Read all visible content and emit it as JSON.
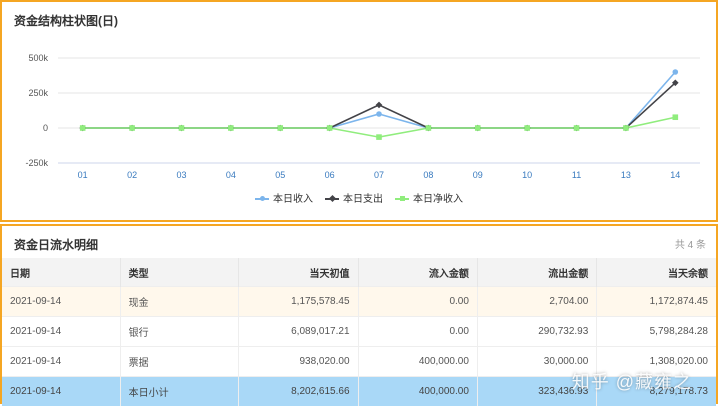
{
  "chart_panel": {
    "title": "资金结构柱状图(日)"
  },
  "chart_data": {
    "type": "line",
    "x": [
      "01",
      "02",
      "03",
      "04",
      "05",
      "06",
      "07",
      "08",
      "09",
      "10",
      "11",
      "13",
      "14"
    ],
    "y_ticks": [
      "500k",
      "250k",
      "0",
      "-250k"
    ],
    "ylim": [
      -250000,
      500000
    ],
    "grid": true,
    "legend_position": "bottom",
    "series": [
      {
        "name": "本日收入",
        "color": "#7cb5ec",
        "marker": "circle",
        "values": [
          0,
          0,
          0,
          0,
          0,
          0,
          100000,
          0,
          0,
          0,
          0,
          0,
          400000
        ]
      },
      {
        "name": "本日支出",
        "color": "#434348",
        "marker": "diamond",
        "values": [
          0,
          0,
          0,
          0,
          0,
          0,
          165000,
          0,
          0,
          0,
          0,
          0,
          323000
        ]
      },
      {
        "name": "本日净收入",
        "color": "#90ed7d",
        "marker": "square",
        "values": [
          0,
          0,
          0,
          0,
          0,
          0,
          -65000,
          0,
          0,
          0,
          0,
          0,
          77000
        ]
      }
    ]
  },
  "table_panel": {
    "title": "资金日流水明细",
    "count": "共 4 条",
    "columns": [
      "日期",
      "类型",
      "当天初值",
      "流入金额",
      "流出金额",
      "当天余额"
    ],
    "rows": [
      [
        "2021-09-14",
        "现金",
        "1,175,578.45",
        "0.00",
        "2,704.00",
        "1,172,874.45"
      ],
      [
        "2021-09-14",
        "银行",
        "6,089,017.21",
        "0.00",
        "290,732.93",
        "5,798,284.28"
      ],
      [
        "2021-09-14",
        "票据",
        "938,020.00",
        "400,000.00",
        "30,000.00",
        "1,308,020.00"
      ],
      [
        "2021-09-14",
        "本日小计",
        "8,202,615.66",
        "400,000.00",
        "323,436.93",
        "8,279,178.73"
      ]
    ]
  },
  "watermark": "知乎 @藏雍之"
}
